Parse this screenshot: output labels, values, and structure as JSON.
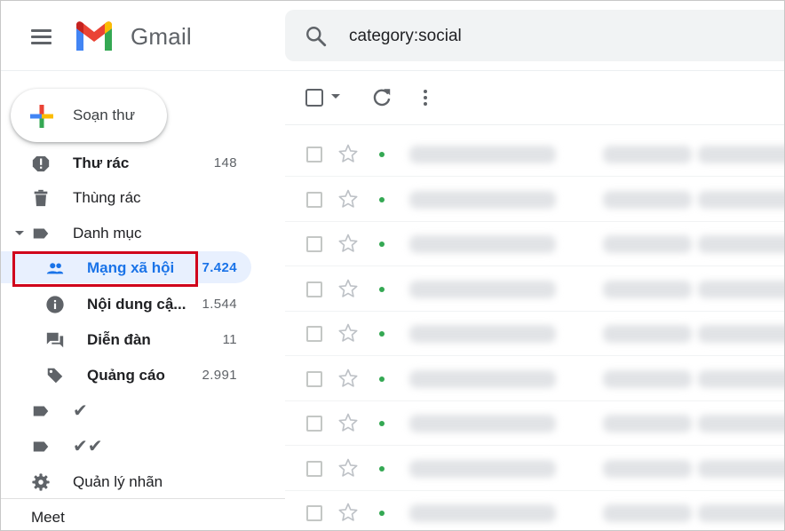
{
  "app": {
    "name": "Gmail"
  },
  "search": {
    "query": "category:social"
  },
  "compose": {
    "label": "Soạn thư"
  },
  "sidebar": {
    "items": [
      {
        "label": "Thư rác",
        "count": "148"
      },
      {
        "label": "Thùng rác"
      },
      {
        "label": "Danh mục"
      },
      {
        "label": "Mạng xã hội",
        "count": "7.424"
      },
      {
        "label": "Nội dung cậ...",
        "count": "1.544"
      },
      {
        "label": "Diễn đàn",
        "count": "11"
      },
      {
        "label": "Quảng cáo",
        "count": "2.991"
      },
      {
        "label": "✔"
      },
      {
        "label": "✔✔"
      },
      {
        "label": "Quản lý nhãn"
      }
    ],
    "meet_label": "Meet"
  },
  "icons": {
    "menu": "hamburger-menu-icon",
    "search": "search-icon",
    "refresh": "refresh-icon",
    "more": "more-vertical-icon",
    "star": "star-outline-icon"
  },
  "colors": {
    "accent": "#1a73e8",
    "active_bg": "#e8f0fe",
    "highlight": "#d0021b",
    "unread_dot": "#34a853"
  }
}
